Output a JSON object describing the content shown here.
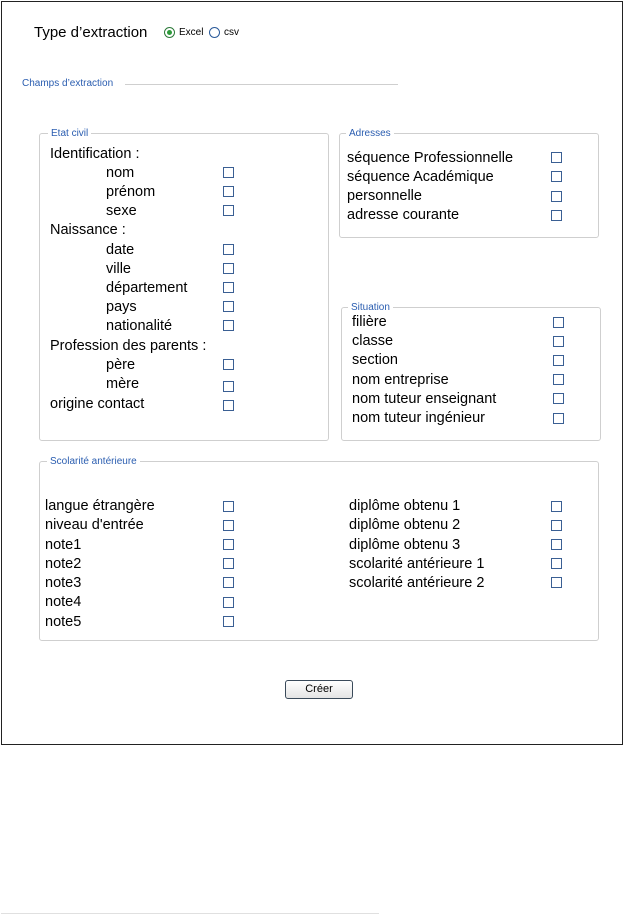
{
  "extraction_type": {
    "label": "Type d’extraction",
    "options": [
      {
        "label": "Excel",
        "selected": true
      },
      {
        "label": "csv",
        "selected": false
      }
    ]
  },
  "champs_label": "Champs d’extraction",
  "etat_civil": {
    "legend": "Etat civil",
    "identification": "Identification :",
    "nom": "nom",
    "prenom": "prénom",
    "sexe": "sexe",
    "naissance": "Naissance :",
    "date": "date",
    "ville": "ville",
    "departement": "département",
    "pays": "pays",
    "nationalite": "nationalité",
    "profession": "Profession des parents :",
    "pere": "père",
    "mere": "mère",
    "origine": "origine contact"
  },
  "adresses": {
    "legend": "Adresses",
    "items": [
      "séquence Professionnelle",
      "séquence Académique",
      "personnelle",
      "adresse courante"
    ]
  },
  "situation": {
    "legend": "Situation",
    "items": [
      "filière",
      "classe",
      "section",
      "nom entreprise",
      "nom tuteur enseignant",
      "nom tuteur ingénieur"
    ]
  },
  "scolarite": {
    "legend": "Scolarité antérieure",
    "left": [
      "langue étrangère",
      "niveau d'entrée",
      "note1",
      "note2",
      "note3",
      "note4",
      "note5"
    ],
    "right": [
      "diplôme obtenu 1",
      "diplôme obtenu 2",
      "diplôme obtenu 3",
      "scolarité antérieure 1",
      "scolarité antérieure 2"
    ]
  },
  "create_button": "Créer"
}
